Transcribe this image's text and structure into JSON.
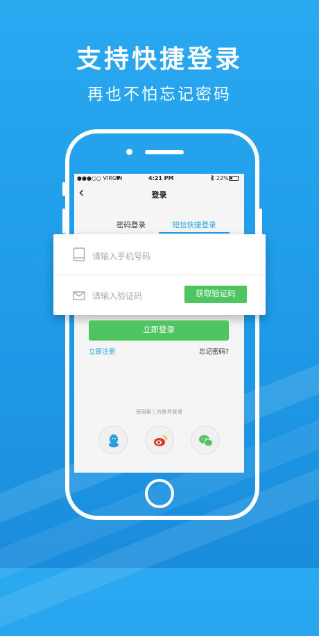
{
  "promo": {
    "headline": "支持快捷登录",
    "subline": "再也不怕忘记密码"
  },
  "statusbar": {
    "carrier": "●●●○○ VIRGIN",
    "time": "4:21 PM",
    "battery": "22%"
  },
  "navbar": {
    "back_glyph": "‹",
    "title": "登录"
  },
  "tabs": [
    {
      "label": "密码登录",
      "active": false
    },
    {
      "label": "短信快捷登录",
      "active": true
    }
  ],
  "form": {
    "phone_placeholder": "请输入手机号码",
    "code_placeholder": "请输入验证码",
    "get_code_label": "获取验证码",
    "login_label": "立即登录",
    "register_label": "立即注册",
    "forgot_label": "忘记密码?"
  },
  "third_party": {
    "label": "使用第三方账号登录",
    "icons": [
      "qq-icon",
      "weibo-icon",
      "wechat-icon"
    ]
  },
  "colors": {
    "background": "#2aa8f0",
    "accent_blue": "#24a0e8",
    "green": "#4fc561",
    "qq": "#2d9ee0",
    "weibo": "#e6332a",
    "wechat": "#4fc561"
  }
}
